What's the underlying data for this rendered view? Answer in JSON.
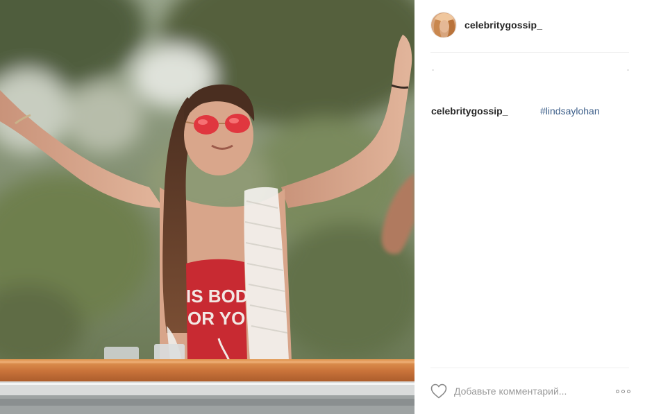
{
  "post": {
    "username": "celebritygossip_",
    "caption": {
      "author": "celebritygossip_",
      "hashtag": "#lindsaylohan"
    },
    "photo": {
      "shirt_text_line1": "IS BOD",
      "shirt_text_line2": "OR YO"
    },
    "comment_input": {
      "placeholder": "Добавьте комментарий..."
    }
  },
  "icons": {
    "like": "heart-icon",
    "more": "more-options-icon"
  },
  "colors": {
    "username": "#262626",
    "hashtag": "#3b5d88",
    "placeholder": "#999999",
    "divider": "#efefef"
  }
}
